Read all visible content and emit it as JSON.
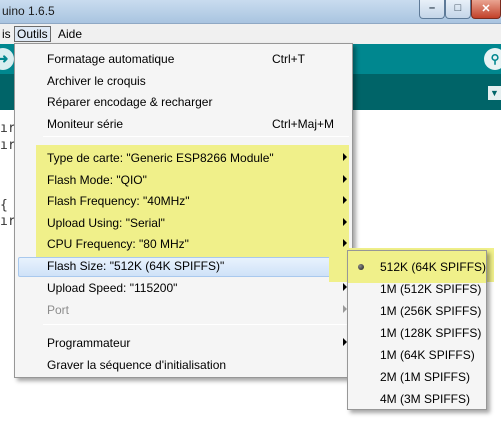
{
  "window": {
    "title": "uino 1.6.5",
    "min_glyph": "–",
    "max_glyph": "□",
    "close_glyph": "✕"
  },
  "menubar": {
    "cut_item": "is",
    "items": [
      "Outils",
      "Aide"
    ]
  },
  "toolbar": {
    "icons": [
      "upload-icon",
      "serial-monitor-icon",
      "tab-menu-icon"
    ],
    "upload_glyph": "➜",
    "monitor_glyph": "⚲",
    "tab_menu_glyph": "▼"
  },
  "editor": {
    "fragments": [
      "ır",
      "ır",
      "{",
      "ır"
    ]
  },
  "outils_menu": {
    "items": [
      {
        "label": "Formatage automatique",
        "shortcut": "Ctrl+T"
      },
      {
        "label": "Archiver le croquis"
      },
      {
        "label": "Réparer encodage & recharger"
      },
      {
        "label": "Moniteur série",
        "shortcut": "Ctrl+Maj+M"
      },
      {
        "label": "Type de carte: \"Generic ESP8266 Module\"",
        "submenu": true
      },
      {
        "label": "Flash Mode: \"QIO\"",
        "submenu": true
      },
      {
        "label": "Flash Frequency: \"40MHz\"",
        "submenu": true
      },
      {
        "label": "Upload Using: \"Serial\"",
        "submenu": true
      },
      {
        "label": "CPU Frequency: \"80 MHz\"",
        "submenu": true
      },
      {
        "label": "Flash Size: \"512K (64K SPIFFS)\"",
        "submenu": true,
        "hovered": true
      },
      {
        "label": "Upload Speed: \"115200\"",
        "submenu": true
      },
      {
        "label": "Port",
        "submenu": true,
        "disabled": true
      },
      {
        "label": "Programmateur",
        "submenu": true
      },
      {
        "label": "Graver la séquence d'initialisation"
      }
    ]
  },
  "flash_size_submenu": {
    "selected_index": 0,
    "options": [
      "512K (64K SPIFFS)",
      "1M (512K SPIFFS)",
      "1M (256K SPIFFS)",
      "1M (128K SPIFFS)",
      "1M (64K SPIFFS)",
      "2M (1M SPIFFS)",
      "4M (3M SPIFFS)"
    ]
  },
  "colors": {
    "toolbar": "#00878f",
    "tabbar": "#006468",
    "annotation_highlight": "#f0f08a",
    "menu_background": "#f5f5f5",
    "hover": "#cfe2f8"
  }
}
